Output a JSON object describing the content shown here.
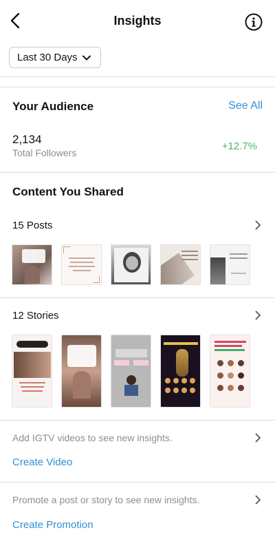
{
  "header": {
    "title": "Insights",
    "back_icon": "chevron-left-icon",
    "info_icon": "info-icon"
  },
  "date_range": {
    "selected": "Last 30 Days",
    "icon": "chevron-down-icon"
  },
  "audience": {
    "title": "Your Audience",
    "see_all": "See All",
    "followers_count": "2,134",
    "followers_label": "Total Followers",
    "followers_change": "+12.7%",
    "change_color": "#58b25f"
  },
  "content": {
    "title": "Content You Shared",
    "posts_label": "15 Posts",
    "stories_label": "12 Stories",
    "post_thumbnails": [
      "post-thumbnail",
      "post-thumbnail",
      "post-thumbnail",
      "post-thumbnail",
      "post-thumbnail"
    ],
    "story_thumbnails": [
      "story-thumbnail",
      "story-thumbnail",
      "story-thumbnail",
      "story-thumbnail",
      "story-thumbnail"
    ]
  },
  "igtv": {
    "hint": "Add IGTV videos to see new insights.",
    "action": "Create Video"
  },
  "promotion": {
    "hint": "Promote a post or story to see new insights.",
    "action": "Create Promotion"
  },
  "colors": {
    "link": "#2f8fd8",
    "muted_text": "#8e8e8e",
    "divider": "#dbdbdb"
  }
}
